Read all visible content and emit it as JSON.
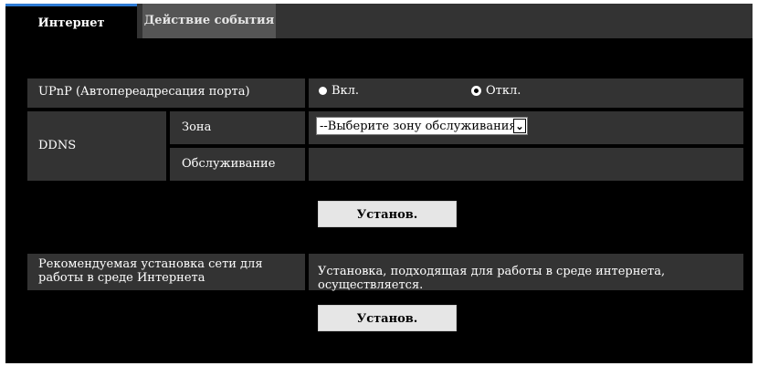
{
  "tabs": [
    {
      "label": "Интернет"
    },
    {
      "label": "Действие события"
    }
  ],
  "upnp": {
    "label": "UPnP (Автопереадресация порта)",
    "on_label": "Вкл.",
    "off_label": "Откл.",
    "selected": "Откл."
  },
  "ddns": {
    "label": "DDNS",
    "zone_label": "Зона",
    "zone_value": "--Выберите зону обслуживания--",
    "service_label": "Обслуживание"
  },
  "set_button_label": "Установ.",
  "recommended": {
    "label": "Рекомендуемая установка сети для работы в среде Интернета",
    "description": "Установка, подходящая для работы в среде интернета, осуществляется."
  },
  "colors": {
    "background": "#000000",
    "row": "#333333",
    "active_tab_accent": "#2e7bd4",
    "button": "#e6e6e6"
  }
}
